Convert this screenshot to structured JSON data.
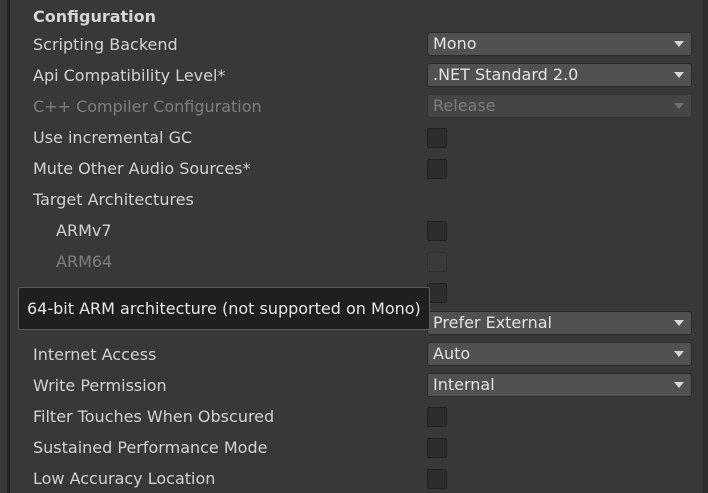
{
  "section": {
    "title": "Configuration"
  },
  "scripting_backend": {
    "label": "Scripting Backend",
    "value": "Mono"
  },
  "api_compat": {
    "label": "Api Compatibility Level*",
    "value": ".NET Standard 2.0"
  },
  "cpp_compiler": {
    "label": "C++ Compiler Configuration",
    "value": "Release"
  },
  "incremental_gc": {
    "label": "Use incremental GC"
  },
  "mute_audio": {
    "label": "Mute Other Audio Sources*"
  },
  "target_arch": {
    "label": "Target Architectures",
    "armv7": "ARMv7",
    "arm64": "ARM64"
  },
  "tooltip": {
    "text": "64-bit ARM architecture (not supported on Mono)"
  },
  "install_location": {
    "value": "Prefer External"
  },
  "internet_access": {
    "label": "Internet Access",
    "value": "Auto"
  },
  "write_permission": {
    "label": "Write Permission",
    "value": "Internal"
  },
  "filter_touches": {
    "label": "Filter Touches When Obscured"
  },
  "sustained_perf": {
    "label": "Sustained Performance Mode"
  },
  "low_accuracy": {
    "label": "Low Accuracy Location"
  },
  "icons": {
    "dropdown_arrow": "chevron-down-icon"
  }
}
